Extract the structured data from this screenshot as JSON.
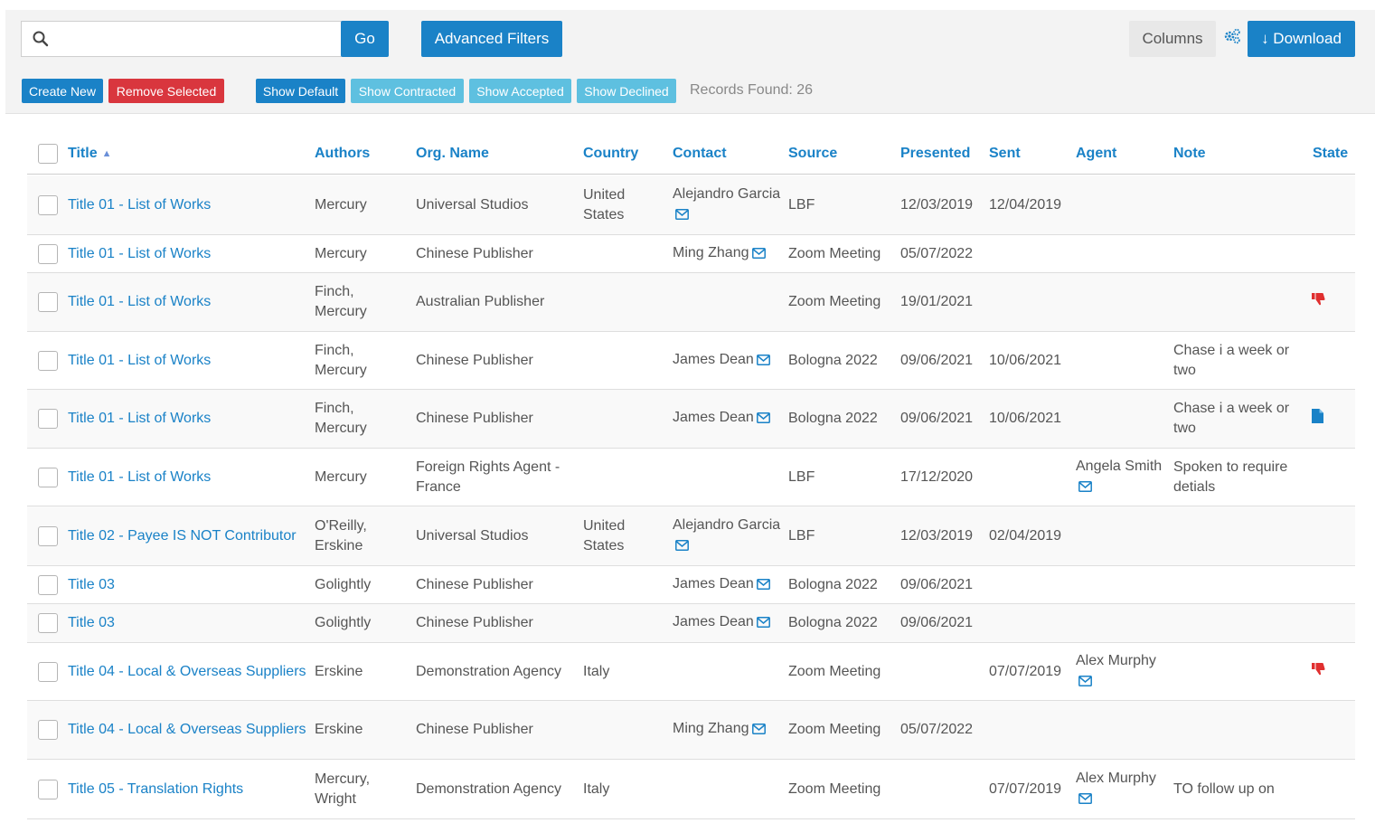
{
  "toolbar": {
    "search_value": "",
    "go_label": "Go",
    "advanced_filters_label": "Advanced Filters",
    "columns_label": "Columns",
    "download_label": "↓ Download",
    "create_new_label": "Create New",
    "remove_selected_label": "Remove Selected",
    "show_default_label": "Show Default",
    "show_contracted_label": "Show Contracted",
    "show_accepted_label": "Show Accepted",
    "show_declined_label": "Show Declined",
    "records_found": "Records Found: 26"
  },
  "colors": {
    "primary": "#1a82c7",
    "danger": "#d9363e",
    "info": "#5ec0e0",
    "declined_icon": "#e03030"
  },
  "table": {
    "headers": {
      "title": "Title",
      "authors": "Authors",
      "org": "Org. Name",
      "country": "Country",
      "contact": "Contact",
      "source": "Source",
      "presented": "Presented",
      "sent": "Sent",
      "agent": "Agent",
      "note": "Note",
      "state": "State"
    },
    "rows": [
      {
        "title": "Title 01 - List of Works",
        "authors": "Mercury",
        "org": "Universal Studios",
        "country": "United States",
        "contact": "Alejandro Garcia",
        "source": "LBF",
        "presented": "12/03/2019",
        "sent": "12/04/2019",
        "agent": "",
        "note": "",
        "state_icon": ""
      },
      {
        "title": "Title 01 - List of Works",
        "authors": "Mercury",
        "org": "Chinese Publisher",
        "country": "",
        "contact": "Ming Zhang",
        "source": "Zoom Meeting",
        "presented": "05/07/2022",
        "sent": "",
        "agent": "",
        "note": "",
        "state_icon": ""
      },
      {
        "title": "Title 01 - List of Works",
        "authors": "Finch, Mercury",
        "org": "Australian Publisher",
        "country": "",
        "contact": "",
        "source": "Zoom Meeting",
        "presented": "19/01/2021",
        "sent": "",
        "agent": "",
        "note": "",
        "state_icon": "thumbs-down-icon"
      },
      {
        "title": "Title 01 - List of Works",
        "authors": "Finch, Mercury",
        "org": "Chinese Publisher",
        "country": "",
        "contact": "James Dean",
        "source": "Bologna 2022",
        "presented": "09/06/2021",
        "sent": "10/06/2021",
        "agent": "",
        "note": "Chase i a week or two",
        "state_icon": ""
      },
      {
        "title": "Title 01 - List of Works",
        "authors": "Finch, Mercury",
        "org": "Chinese Publisher",
        "country": "",
        "contact": "James Dean",
        "source": "Bologna 2022",
        "presented": "09/06/2021",
        "sent": "10/06/2021",
        "agent": "",
        "note": "Chase i a week or two",
        "state_icon": "document-icon"
      },
      {
        "title": "Title 01 - List of Works",
        "authors": "Mercury",
        "org": "Foreign Rights Agent - France",
        "country": "",
        "contact": "",
        "source": "LBF",
        "presented": "17/12/2020",
        "sent": "",
        "agent": "Angela Smith",
        "note": "Spoken to require detials",
        "state_icon": ""
      },
      {
        "title": "Title 02 - Payee IS NOT Contributor",
        "authors": "O'Reilly, Erskine",
        "org": "Universal Studios",
        "country": "United States",
        "contact": "Alejandro Garcia",
        "source": "LBF",
        "presented": "12/03/2019",
        "sent": "02/04/2019",
        "agent": "",
        "note": "",
        "state_icon": ""
      },
      {
        "title": "Title 03",
        "authors": "Golightly",
        "org": "Chinese Publisher",
        "country": "",
        "contact": "James Dean",
        "source": "Bologna 2022",
        "presented": "09/06/2021",
        "sent": "",
        "agent": "",
        "note": "",
        "state_icon": ""
      },
      {
        "title": "Title 03",
        "authors": "Golightly",
        "org": "Chinese Publisher",
        "country": "",
        "contact": "James Dean",
        "source": "Bologna 2022",
        "presented": "09/06/2021",
        "sent": "",
        "agent": "",
        "note": "",
        "state_icon": ""
      },
      {
        "title": "Title 04 - Local & Overseas Suppliers",
        "authors": "Erskine",
        "org": "Demonstration Agency",
        "country": "Italy",
        "contact": "",
        "source": "Zoom Meeting",
        "presented": "",
        "sent": "07/07/2019",
        "agent": "Alex Murphy",
        "note": "",
        "state_icon": "thumbs-down-icon"
      },
      {
        "title": "Title 04 - Local & Overseas Suppliers",
        "authors": "Erskine",
        "org": "Chinese Publisher",
        "country": "",
        "contact": "Ming Zhang",
        "source": "Zoom Meeting",
        "presented": "05/07/2022",
        "sent": "",
        "agent": "",
        "note": "",
        "state_icon": ""
      },
      {
        "title": "Title 05 - Translation Rights",
        "authors": "Mercury, Wright",
        "org": "Demonstration Agency",
        "country": "Italy",
        "contact": "",
        "source": "Zoom Meeting",
        "presented": "",
        "sent": "07/07/2019",
        "agent": "Alex Murphy",
        "note": "TO follow up on",
        "state_icon": ""
      }
    ]
  }
}
